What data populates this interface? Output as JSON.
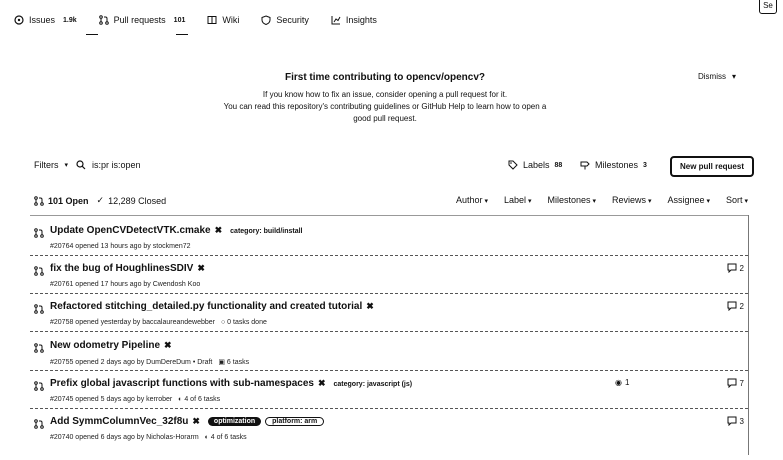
{
  "corner_label": "Se",
  "tabs": [
    {
      "label": "Issues",
      "count": "1.9k",
      "icon": "issue-icon"
    },
    {
      "label": "Pull requests",
      "count": "101",
      "icon": "pr-icon"
    },
    {
      "label": "Wiki",
      "count": "",
      "icon": "book-icon"
    },
    {
      "label": "Security",
      "count": "",
      "icon": "shield-icon"
    },
    {
      "label": "Insights",
      "count": "",
      "icon": "graph-icon"
    }
  ],
  "banner": {
    "title": "First time contributing to opencv/opencv?",
    "line1": "If you know how to fix an issue, consider opening a pull request for it.",
    "line2": "You can read this repository's contributing guidelines or GitHub Help to learn how to open a",
    "line3": "good pull request.",
    "dismiss": "Dismiss"
  },
  "filterbar": {
    "filters": "Filters",
    "search_value": "is:pr is:open",
    "labels": "Labels",
    "labels_count": "88",
    "milestones": "Milestones",
    "milestones_count": "3",
    "new_pr": "New pull request"
  },
  "list": {
    "open": "101 Open",
    "closed": "12,289 Closed",
    "sorts": [
      "Author",
      "Label",
      "Milestones",
      "Reviews",
      "Assignee",
      "Sort"
    ],
    "rows": [
      {
        "title": "Update OpenCVDetectVTK.cmake",
        "label": "category: build/install",
        "meta": "#20764 opened 13 hours ago by stockmen72",
        "comments": ""
      },
      {
        "title": "fix the bug of HoughlinesSDIV",
        "label": "",
        "meta": "#20761 opened 17 hours ago by Cwendosh Koo",
        "comments": "2"
      },
      {
        "title": "Refactored stitching_detailed.py functionality and created tutorial",
        "label": "",
        "meta": "#20758 opened yesterday by baccalaureandewebber",
        "tasks": "0 tasks done",
        "comments": "2"
      },
      {
        "title": "New odometry Pipeline",
        "label": "",
        "meta": "#20755 opened 2 days ago by DumDereDum • Draft",
        "tasks": "6 tasks",
        "comments": ""
      },
      {
        "title": "Prefix global javascript functions with sub-namespaces",
        "label": "category: javascript (js)",
        "meta": "#20745 opened 5 days ago by kerrober",
        "tasks": "4 of 6 tasks",
        "status": "1",
        "comments": "7"
      },
      {
        "title": "Add SymmColumnVec_32f8u",
        "pill_dark": "optimization",
        "pill_out": "platform: arm",
        "meta": "#20740 opened 6 days ago by Nicholas-Horarm",
        "tasks": "4 of 6 tasks",
        "comments": "3"
      }
    ]
  }
}
